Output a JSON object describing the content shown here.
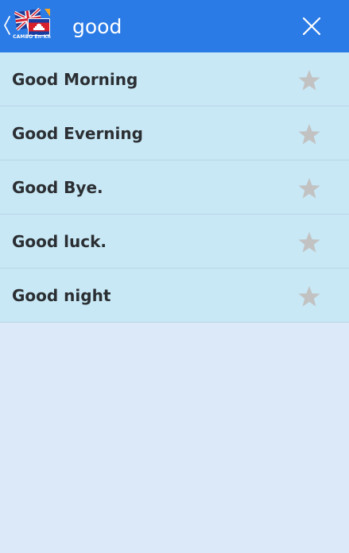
{
  "search": {
    "value": "good",
    "placeholder": ""
  },
  "header": {
    "logo_caption": "CAMBO En-Kh"
  },
  "results": [
    {
      "label": "Good Morning"
    },
    {
      "label": "Good Everning"
    },
    {
      "label": "Good Bye."
    },
    {
      "label": "Good luck."
    },
    {
      "label": "Good night"
    }
  ],
  "icons": {
    "back": "chevron-left-icon",
    "logo": "uk-cambodia-flag-logo",
    "clear": "close-icon",
    "favorite": "star-icon"
  },
  "colors": {
    "app_bar": "#2a7be6",
    "list_item_bg": "#c8e8f5",
    "page_bg": "#dbe9f8",
    "star": "#c2c2c2",
    "text": "#2b2f33"
  }
}
